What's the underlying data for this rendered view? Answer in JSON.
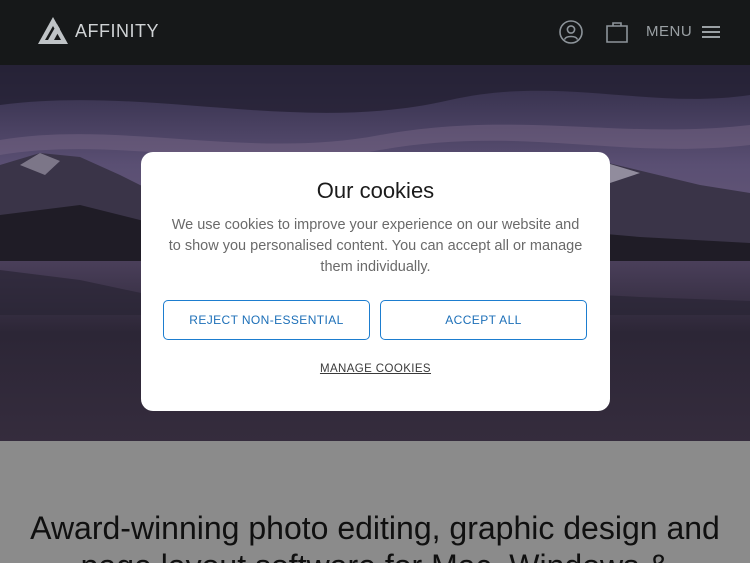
{
  "header": {
    "logo_text": "AFFINITY",
    "logo_icon": "affinity-triangle-logo",
    "user_icon": "user-icon",
    "cart_icon": "bag-icon",
    "menu_label": "MENU",
    "menu_icon": "hamburger-icon"
  },
  "main": {
    "headline": "Award-winning photo editing, graphic design and page layout software for Mac, Windows &"
  },
  "cookie_modal": {
    "title": "Our cookies",
    "body": "We use cookies to improve your experience on our website and to show you personalised content. You can accept all or manage them individually.",
    "reject_label": "REJECT NON-ESSENTIAL",
    "accept_label": "ACCEPT ALL",
    "manage_label": "MANAGE COOKIES"
  },
  "colors": {
    "header_bg": "#161819",
    "button_border": "#1d7dcf",
    "button_text": "#1c6fb8"
  }
}
